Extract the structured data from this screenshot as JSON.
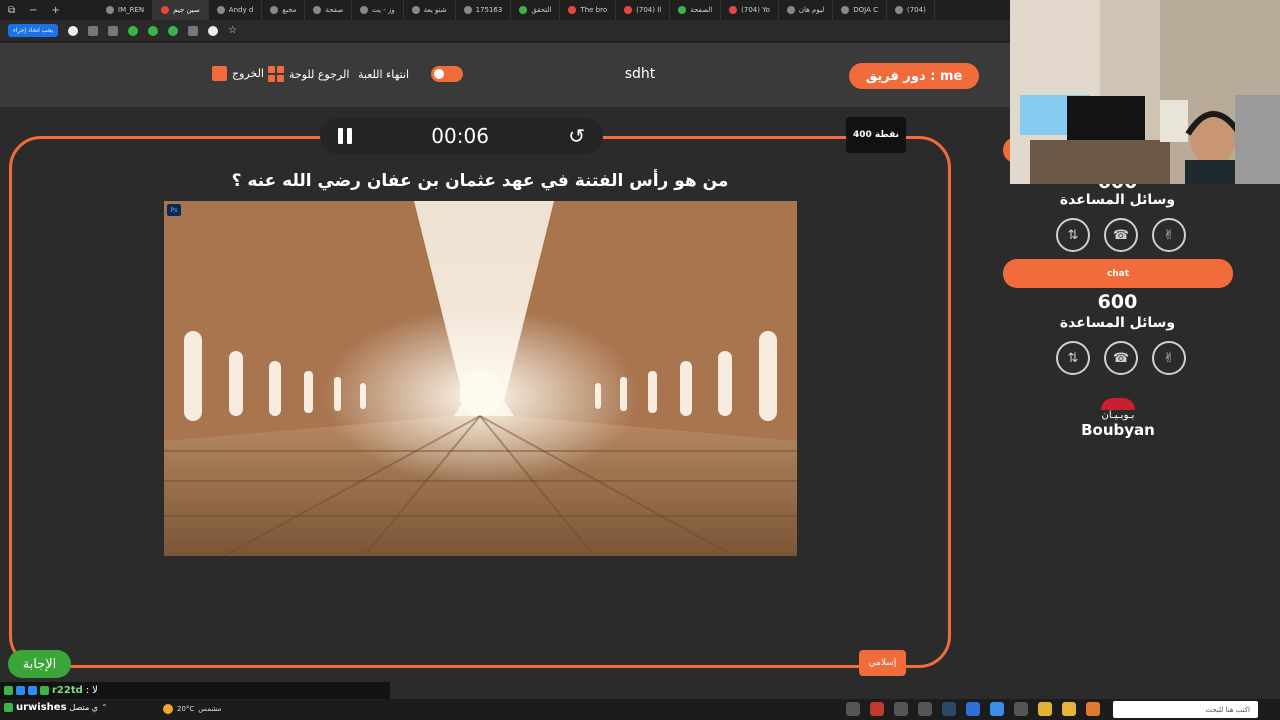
{
  "browser": {
    "window_controls": [
      "⧉",
      "−",
      "+"
    ],
    "tabs": [
      {
        "label": "IM_REN",
        "active": false
      },
      {
        "label": "سين جيم",
        "active": true
      },
      {
        "label": "Andy d",
        "active": false
      },
      {
        "label": "مخبع",
        "active": false
      },
      {
        "label": "صفحة",
        "active": false
      },
      {
        "label": "وز - يت",
        "active": false
      },
      {
        "label": "شنو يعة",
        "active": false
      },
      {
        "label": "175163",
        "active": false
      },
      {
        "label": "التحقق",
        "active": false
      },
      {
        "label": "The bro",
        "active": false
      },
      {
        "label": "(704) Il",
        "active": false
      },
      {
        "label": "الصفحة",
        "active": false
      },
      {
        "label": "(704) Yo",
        "active": false
      },
      {
        "label": "ليوم هان",
        "active": false
      },
      {
        "label": "DOJA C",
        "active": false
      },
      {
        "label": "(704)",
        "active": false
      }
    ],
    "bookmark_pill": "يجب اتخاذ إجراء"
  },
  "header": {
    "team_label": "دور فريق : me",
    "game_title": "sdht",
    "end_game": "انتهاء اللعبة",
    "back_to_board": "الرجوع للوحة",
    "exit": "الخروج"
  },
  "board": {
    "timer": "00:06",
    "points": "400 نقطة",
    "question": "من هو رأس الفتنة في عهد عثمان بن عفان رضي الله عنه ؟",
    "image_badge": "Ps",
    "category": "إسلامي",
    "answer_button": "الإجابة"
  },
  "teams": [
    {
      "name": "",
      "score": "600",
      "help_label": "وسائل المساعدة"
    },
    {
      "name": "chat",
      "score": "600",
      "help_label": "وسائل المساعدة"
    }
  ],
  "lifeline_icons": [
    "✌",
    "☎",
    "⇅"
  ],
  "sponsor": {
    "arabic": "بـوبـيـان",
    "english": "Boubyan"
  },
  "chat": {
    "user": "r22td",
    "message": "لا"
  },
  "taskbar": {
    "user": "urwishes",
    "status": "ي متصل",
    "weather_temp": "20°C",
    "weather_desc": "مشمس",
    "search_placeholder": "اكتب هنا للبحث"
  },
  "colors": {
    "accent": "#f26b3a",
    "answer": "#3aa63a",
    "background": "#2b2b2b"
  }
}
